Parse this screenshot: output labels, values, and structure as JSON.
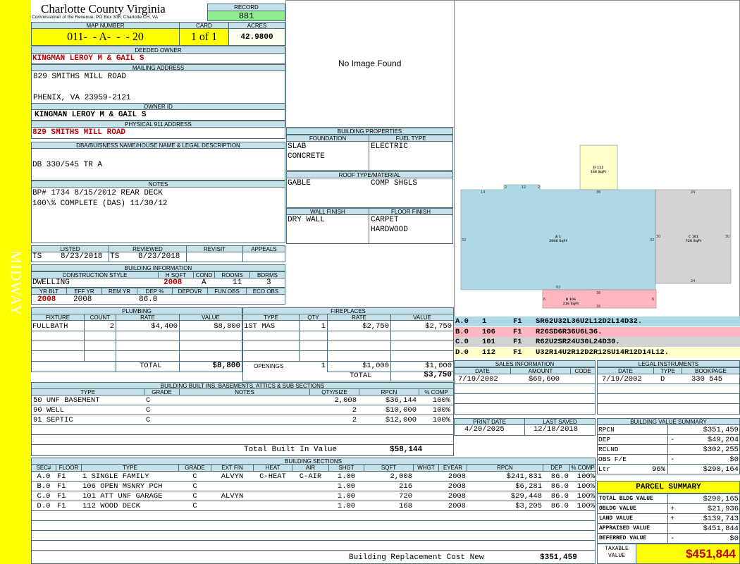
{
  "side_label": "MIDWAY",
  "header": {
    "title": "Charlotte County Virginia",
    "subtitle": "Commissioner of the Revenue, PO Box 308, Charlotte CH, VA"
  },
  "record": {
    "label": "RECORD",
    "value": "881"
  },
  "map": {
    "label": "MAP NUMBER",
    "value": "011-  - A-  -  - 20",
    "card_label": "CARD",
    "card_value": "1 of 1",
    "acres_label": "ACRES",
    "acres_value": "42.9800"
  },
  "deeded_owner": {
    "label": "DEEDED OWNER",
    "value": "KINGMAN LEROY M & GAIL S"
  },
  "mailing": {
    "label": "MAILING ADDRESS",
    "line1": "829 SMITHS MILL ROAD",
    "line2": "PHENIX, VA 23959-2121"
  },
  "owner_id": {
    "label": "OWNER ID",
    "value": "KINGMAN LEROY M & GAIL S"
  },
  "physical": {
    "label": "PHYSICAL 911 ADDRESS",
    "value": "829 SMITHS MILL ROAD"
  },
  "dba": {
    "label": "DBA/BUISNESS NAME/HOUSE NAME & LEGAL DESCRIPTION",
    "value": "DB 330/545 TR A"
  },
  "notes": {
    "label": "NOTES",
    "line1": "BP# 1734 8/15/2012 REAR DECK",
    "line2": "100\\% COMPLETE (DAS) 11/30/12"
  },
  "listed": {
    "listed_label": "LISTED",
    "reviewed_label": "REVIEWED",
    "revisit_label": "REVISIT",
    "appeals_label": "APPEALS",
    "listed_by": "TS",
    "listed_date": "8/23/2018",
    "reviewed_by": "TS",
    "reviewed_date": "8/23/2018"
  },
  "building_info": {
    "label": "BUILDING INFORMATION",
    "h": {
      "style": "CONSTRUCTION STYLE",
      "hsqft": "H SQFT",
      "cond": "COND",
      "rooms": "ROOMS",
      "bdrms": "BDRMS",
      "yrblt": "YR BLT",
      "effyr": "EFF YR",
      "remyr": "REM YR",
      "dep": "DEP %",
      "depovr": "DEPOVR",
      "funobs": "FUN OBS",
      "ecoobs": "ECO OBS"
    },
    "v": {
      "style": "DWELLING",
      "hsqft": "2008",
      "cond": "A",
      "rooms": "11",
      "bdrms": "3",
      "yrblt": "2008",
      "effyr": "2008",
      "remyr": "",
      "dep": "86.0",
      "depovr": "",
      "funobs": "",
      "ecoobs": ""
    }
  },
  "image": {
    "text": "No Image Found"
  },
  "building_props": {
    "label": "BUILDING PROPERTIES",
    "foundation_label": "FOUNDATION",
    "foundation": [
      "SLAB",
      "CONCRETE"
    ],
    "fuel_label": "FUEL TYPE",
    "fuel": [
      "ELECTRIC"
    ],
    "roof_label": "ROOF TYPE/MATERIAL",
    "roof": [
      "GABLE",
      "COMP SHGLS"
    ],
    "wall_label": "WALL FINISH",
    "wall": [
      "DRY WALL"
    ],
    "floor_label": "FLOOR FINISH",
    "floor": [
      "CARPET",
      "HARDWOOD"
    ]
  },
  "sketch": {
    "a": {
      "label": "A 1",
      "area": "2008 SqFt",
      "dims": [
        "14",
        "2",
        "12",
        "2",
        "36",
        "32",
        "32",
        "62"
      ]
    },
    "b": {
      "label": "B 106",
      "area": "216 SqFt",
      "dims": [
        "36",
        "6",
        "6",
        "36"
      ]
    },
    "c": {
      "label": "C 101",
      "area": "720 SqFt",
      "dims": [
        "24",
        "30",
        "30",
        "24"
      ]
    },
    "d": {
      "label": "D 112",
      "area": "168 SqFt"
    },
    "colors": {
      "a": "#add8e6",
      "b": "#ffb6c1",
      "c": "#d3d3d3",
      "d": "#ffffcc"
    },
    "legend": [
      {
        "code": "A.0",
        "num": "1",
        "floor": "F1",
        "path": "SR62U32L36U2L12D2L14D32.",
        "color": "#add8e6"
      },
      {
        "code": "B.0",
        "num": "106",
        "floor": "F1",
        "path": "R26SD6R36U6L36.",
        "color": "#ffb6c1"
      },
      {
        "code": "C.0",
        "num": "101",
        "floor": "F1",
        "path": "R62U2SR24U30L24D30.",
        "color": "#d3d3d3"
      },
      {
        "code": "D.0",
        "num": "112",
        "floor": "F1",
        "path": "U32R14U2R12D2R12SU14R12D14L12.",
        "color": "#ffffcc"
      }
    ]
  },
  "plumbing": {
    "label": "PLUMBING",
    "h": [
      "FIXTURE",
      "COUNT",
      "RATE",
      "VALUE"
    ],
    "rows": [
      [
        "FULLBATH",
        "2",
        "$4,400",
        "$8,800"
      ]
    ],
    "total_label": "TOTAL",
    "total": "$8,800"
  },
  "fireplaces": {
    "label": "FIREPLACES",
    "h": [
      "TYPE",
      "QTY",
      "RATE",
      "VALUE"
    ],
    "rows": [
      [
        "1ST MAS",
        "1",
        "$2,750",
        "$2,750"
      ]
    ],
    "openings_label": "OPENINGS",
    "openings": [
      "1",
      "$1,000",
      "$1,000"
    ],
    "total_label": "TOTAL",
    "total": "$3,750"
  },
  "builtins": {
    "label": "BUILDING BUILT INS, BASEMENTS, ATTICS & SUB SECTIONS",
    "h": [
      "TYPE",
      "GRADE",
      "NOTES",
      "QTY/SIZE",
      "RPCN",
      "% COMP"
    ],
    "rows": [
      [
        "50 UNF BASEMENT",
        "C",
        "",
        "2,008",
        "$36,144",
        "100%"
      ],
      [
        "90 WELL",
        "C",
        "",
        "2",
        "$10,000",
        "100%"
      ],
      [
        "91 SEPTIC",
        "C",
        "",
        "2",
        "$12,000",
        "100%"
      ]
    ],
    "total_label": "Total Built In Value",
    "total": "$58,144"
  },
  "sales": {
    "label": "SALES INFORMATION",
    "h": [
      "DATE",
      "AMOUNT",
      "CODE"
    ],
    "rows": [
      [
        "7/19/2002",
        "$69,600",
        ""
      ]
    ]
  },
  "legal": {
    "label": "LEGAL INSTRUMENTS",
    "h": [
      "DATE",
      "TYPE",
      "BOOKPAGE"
    ],
    "rows": [
      [
        "7/19/2002",
        "D",
        "330 545"
      ]
    ]
  },
  "print": {
    "print_label": "PRINT DATE",
    "print_date": "4/20/2025",
    "saved_label": "LAST SAVED",
    "saved_date": "12/18/2018"
  },
  "value_summary": {
    "label": "BUILDING VALUE SUMMARY",
    "rows": [
      {
        "k": "RPCN",
        "s": "",
        "v": "$351,459"
      },
      {
        "k": "DEP",
        "s": "-",
        "v": "$49,204"
      },
      {
        "k": "RCLND",
        "s": "",
        "v": "$302,255"
      },
      {
        "k": "OBS F/E",
        "s": "-",
        "v": "$0"
      },
      {
        "k": "Ltr",
        "pct": "96%",
        "s": "",
        "v": "$290,164"
      }
    ]
  },
  "parcel": {
    "label": "PARCEL SUMMARY",
    "rows": [
      {
        "k": "TOTAL BLDG VALUE",
        "s": "",
        "v": "$290,165"
      },
      {
        "k": "OBLDG VALUE",
        "s": "+",
        "v": "$21,936"
      },
      {
        "k": "LAND VALUE",
        "s": "+",
        "v": "$139,743"
      },
      {
        "k": "APPRAISED VALUE",
        "s": "",
        "v": "$451,844"
      },
      {
        "k": "DEFERRED VALUE",
        "s": "-",
        "v": "$0"
      }
    ],
    "taxable_label": "TAXABLE VALUE",
    "taxable": "$451,844"
  },
  "sections": {
    "label": "BUILDING SECTIONS",
    "h": [
      "SEC#",
      "FLOOR",
      "TYPE",
      "GRADE",
      "EXT FIN",
      "HEAT",
      "AIR",
      "SHGT",
      "SQFT",
      "WHGT",
      "EYEAR",
      "RPCN",
      "DEP",
      "% COMP"
    ],
    "rows": [
      [
        "A.0",
        "F1",
        "1 SINGLE FAMILY",
        "C",
        "ALVYN",
        "C-HEAT",
        "C-AIR",
        "1.00",
        "2,008",
        "",
        "2008",
        "$241,831",
        "86.0",
        "100%"
      ],
      [
        "B.0",
        "F1",
        "106 OPEN MSNRY PCH",
        "C",
        "",
        "",
        "",
        "1.00",
        "216",
        "",
        "2008",
        "$6,281",
        "86.0",
        "100%"
      ],
      [
        "C.0",
        "F1",
        "101 ATT UNF GARAGE",
        "C",
        "ALVYN",
        "",
        "",
        "1.00",
        "720",
        "",
        "2008",
        "$29,448",
        "86.0",
        "100%"
      ],
      [
        "D.0",
        "F1",
        "112 WOOD DECK",
        "C",
        "",
        "",
        "",
        "1.00",
        "168",
        "",
        "2008",
        "$3,205",
        "86.0",
        "100%"
      ]
    ],
    "total_label": "Building Replacement Cost New",
    "total": "$351,459"
  }
}
